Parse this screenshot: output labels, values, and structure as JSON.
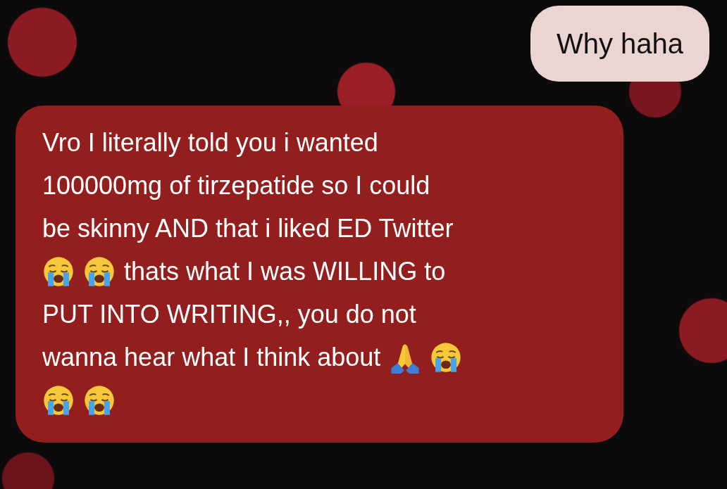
{
  "messages": [
    {
      "kind": "sent",
      "lines": [
        [
          {
            "kind": "text",
            "text": "Why haha"
          }
        ]
      ]
    },
    {
      "kind": "received",
      "lines": [
        [
          {
            "kind": "text",
            "text": "Vro I literally told you i wanted"
          }
        ],
        [
          {
            "kind": "text",
            "text": "100000mg of tirzepatide so I could"
          }
        ],
        [
          {
            "kind": "text",
            "text": "be skinny AND that i liked ED Twitter"
          }
        ],
        [
          {
            "kind": "crying"
          },
          {
            "kind": "crying"
          },
          {
            "kind": "text",
            "text": "thats what I was WILLING to"
          }
        ],
        [
          {
            "kind": "text",
            "text": "PUT INTO WRITING,, you do not"
          }
        ],
        [
          {
            "kind": "text",
            "text": "wanna hear what I think about"
          },
          {
            "kind": "praying"
          },
          {
            "kind": "crying"
          }
        ],
        [
          {
            "kind": "crying"
          },
          {
            "kind": "crying"
          }
        ]
      ]
    }
  ]
}
